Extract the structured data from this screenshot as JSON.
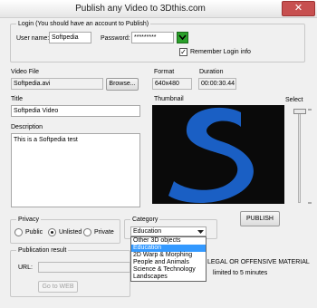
{
  "window": {
    "title": "Publish any Video to 3Dthis.com",
    "close_glyph": "✕"
  },
  "login": {
    "legend": "Login (You should have an account to Publish)",
    "username_label": "User name:",
    "username_value": "Softpedia",
    "password_label": "Password:",
    "password_value": "*********",
    "remember_label": "Remember Login info",
    "remember_checked": true,
    "check_mark": "✓"
  },
  "video_file": {
    "label": "Video File",
    "value": "Softpedia.avi",
    "browse_label": "Browse..."
  },
  "format": {
    "label": "Format",
    "value": "640x480"
  },
  "duration": {
    "label": "Duration",
    "value": "00:00:30.44"
  },
  "title_field": {
    "label": "Title",
    "value": "Softpedia Video"
  },
  "description": {
    "label": "Description",
    "value": "This is a Softpedia test"
  },
  "thumbnail": {
    "label": "Thumbnail",
    "select_label": "Select",
    "logo_letter": "S"
  },
  "privacy": {
    "legend": "Privacy",
    "options": [
      "Public",
      "Unlisted",
      "Private"
    ],
    "selected": "Unlisted"
  },
  "category": {
    "legend": "Category",
    "selected": "Education",
    "options": [
      "Other 3D objects",
      "Education",
      "2D Warp & Morphing",
      "People and Animals",
      "Science & Technology",
      "Landscapes"
    ]
  },
  "publish_label": "PUBLISH",
  "publication_result": {
    "legend": "Publication result",
    "url_label": "URL:",
    "url_value": "",
    "go_to_web_label": "Go to WEB"
  },
  "notices": {
    "line1": "LEGAL OR OFFENSIVE MATERIAL",
    "line2": "limited to 5 minutes"
  },
  "colors": {
    "thumbnail_bg": "#0a0a0a",
    "logo_blue": "#1a5fc4",
    "selection_blue": "#3399ff",
    "close_red": "#c75050",
    "go_button_green": "#2aa02a"
  }
}
